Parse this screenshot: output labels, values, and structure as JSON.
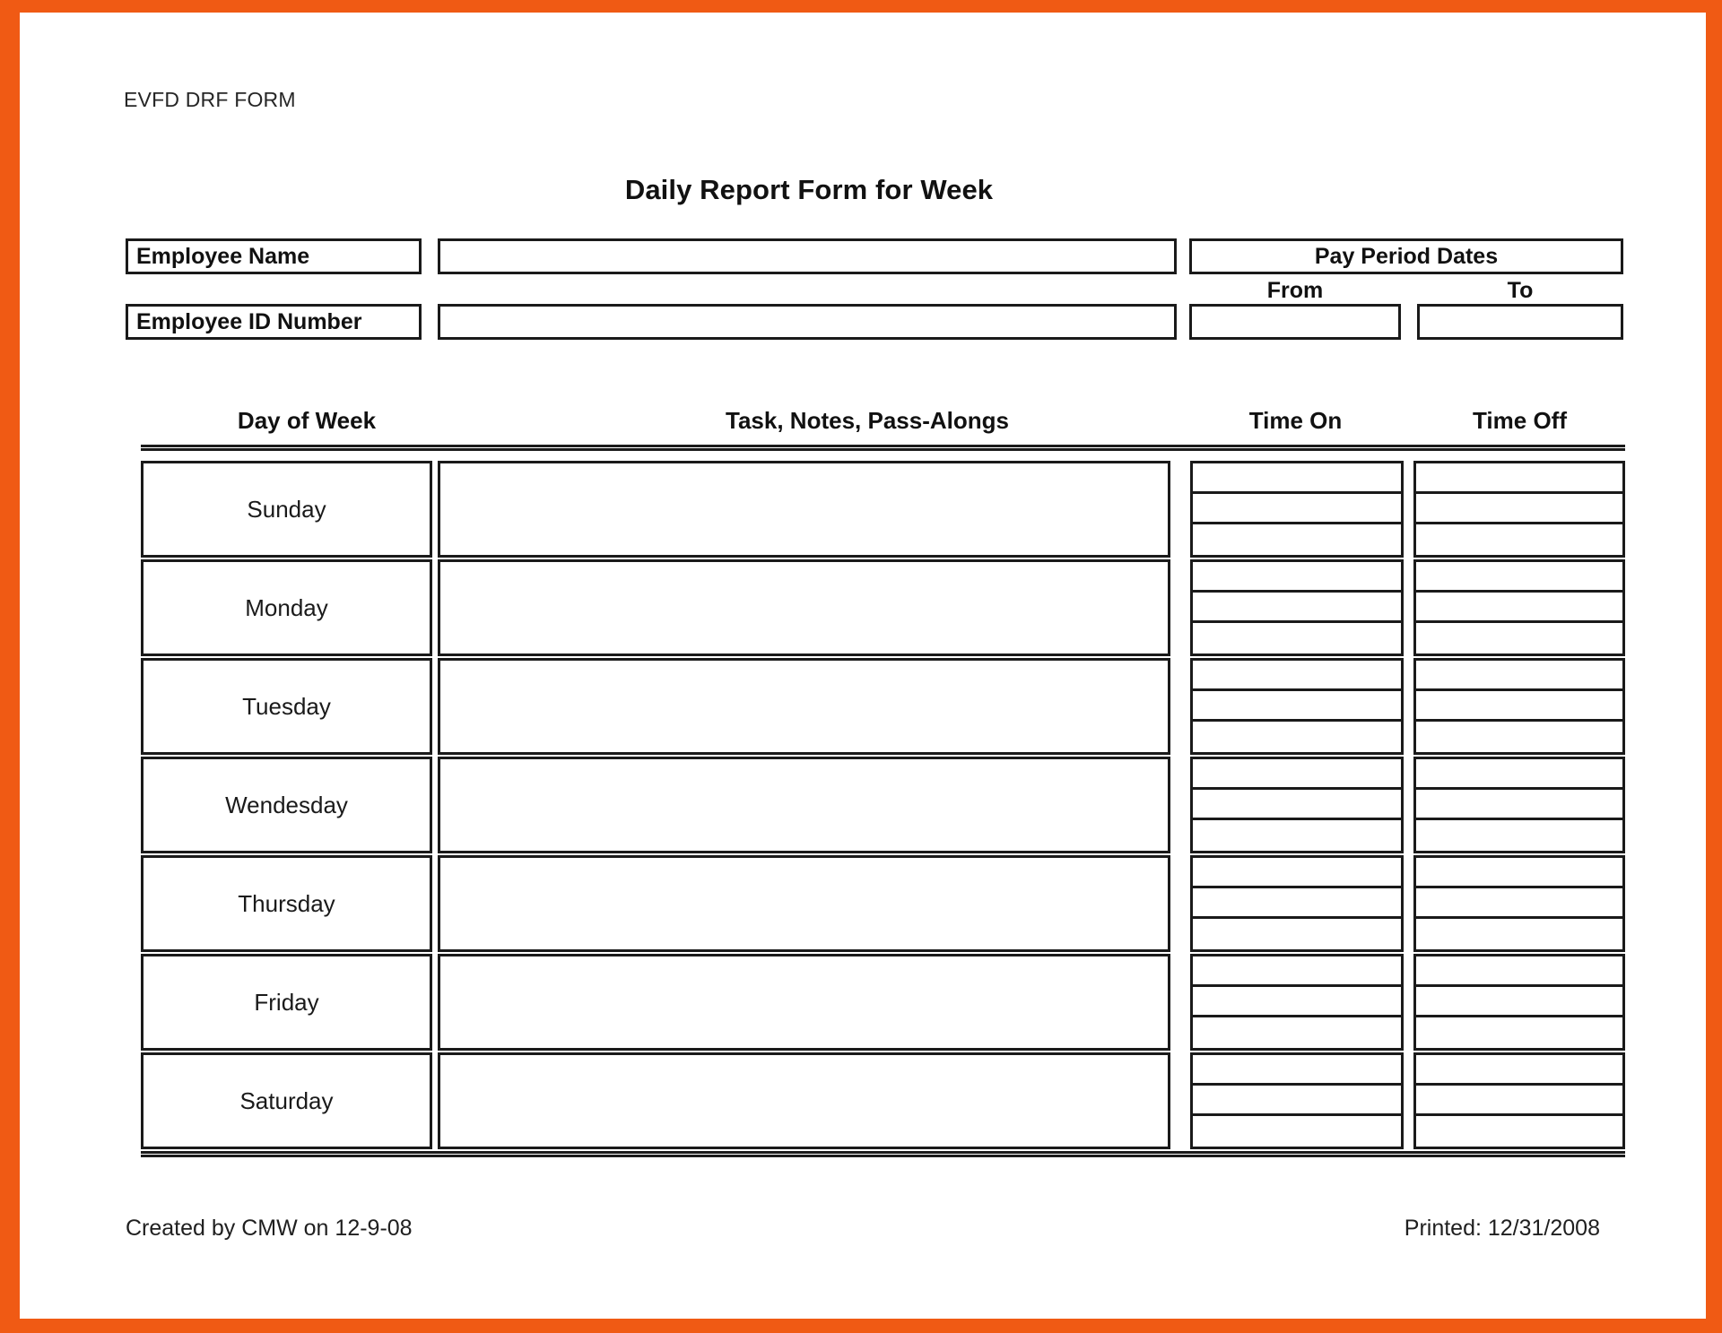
{
  "document": {
    "caption": "EVFD DRF FORM",
    "title": "Daily Report Form for Week",
    "accent_color": "#f05a14",
    "ink_color": "#1a1a1a",
    "paper_color": "#ffffff"
  },
  "employee": {
    "name_label": "Employee Name",
    "name_value": "",
    "name_placeholder": "",
    "id_label": "Employee ID Number",
    "id_value": "",
    "id_placeholder": ""
  },
  "pay_period": {
    "heading": "Pay Period Dates",
    "from_label": "From",
    "to_label": "To",
    "from_value": "",
    "to_value": "",
    "from_placeholder": "",
    "to_placeholder": ""
  },
  "table": {
    "columns": [
      {
        "key": "day",
        "label": "Day of Week"
      },
      {
        "key": "task",
        "label": "Task, Notes, Pass-Alongs"
      },
      {
        "key": "on",
        "label": "Time On"
      },
      {
        "key": "off",
        "label": "Time Off"
      }
    ],
    "sublines_per_time_cell": 3,
    "rows": [
      {
        "day": "Sunday",
        "task": "",
        "time_on": [
          "",
          "",
          ""
        ],
        "time_off": [
          "",
          "",
          ""
        ]
      },
      {
        "day": "Monday",
        "task": "",
        "time_on": [
          "",
          "",
          ""
        ],
        "time_off": [
          "",
          "",
          ""
        ]
      },
      {
        "day": "Tuesday",
        "task": "",
        "time_on": [
          "",
          "",
          ""
        ],
        "time_off": [
          "",
          "",
          ""
        ]
      },
      {
        "day": "Wendesday",
        "task": "",
        "time_on": [
          "",
          "",
          ""
        ],
        "time_off": [
          "",
          "",
          ""
        ]
      },
      {
        "day": "Thursday",
        "task": "",
        "time_on": [
          "",
          "",
          ""
        ],
        "time_off": [
          "",
          "",
          ""
        ]
      },
      {
        "day": "Friday",
        "task": "",
        "time_on": [
          "",
          "",
          ""
        ],
        "time_off": [
          "",
          "",
          ""
        ]
      },
      {
        "day": "Saturday",
        "task": "",
        "time_on": [
          "",
          "",
          ""
        ],
        "time_off": [
          "",
          "",
          ""
        ]
      }
    ]
  },
  "footer": {
    "created": "Created by CMW on 12-9-08",
    "printed": "Printed: 12/31/2008"
  }
}
